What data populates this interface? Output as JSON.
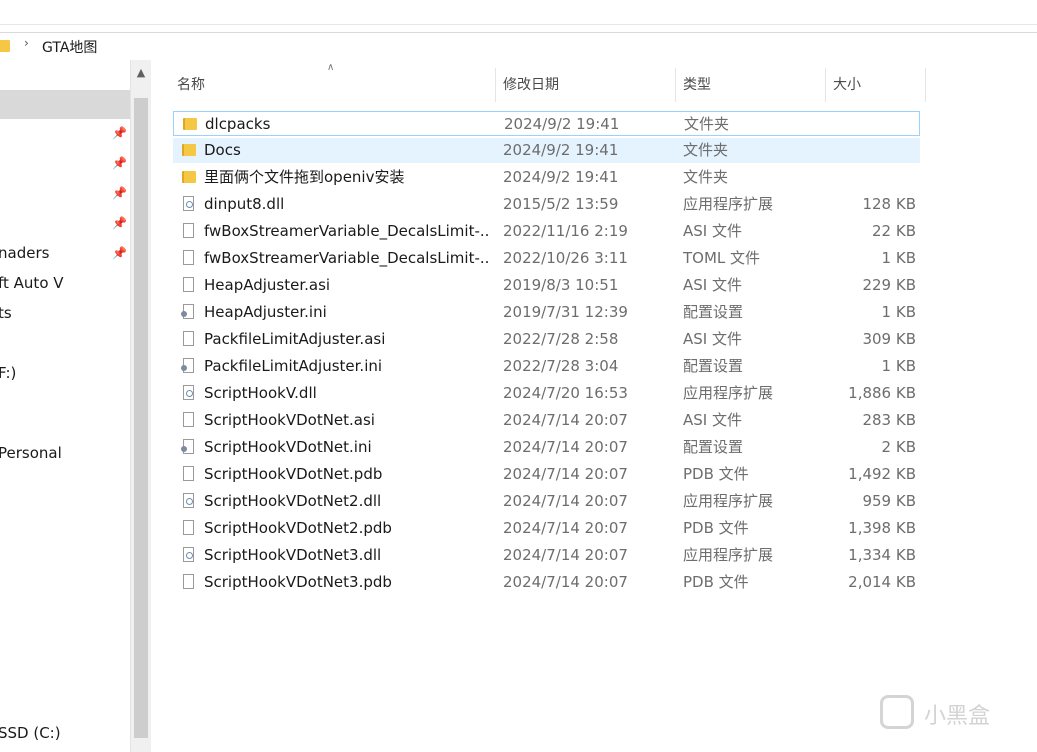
{
  "address": {
    "path": "GTA地图"
  },
  "nav": {
    "labels": [
      "naders",
      "ft Auto V",
      "ts",
      "F:)",
      "Personal",
      "SSD (C:)"
    ]
  },
  "columns": {
    "name": "名称",
    "date": "修改日期",
    "type": "类型",
    "size": "大小"
  },
  "files": [
    {
      "name": "dlcpacks",
      "date": "2024/9/2 19:41",
      "type": "文件夹",
      "size": "",
      "icon": "folder-icon"
    },
    {
      "name": "Docs",
      "date": "2024/9/2 19:41",
      "type": "文件夹",
      "size": "",
      "icon": "folder-icon"
    },
    {
      "name": "里面俩个文件拖到openiv安装",
      "date": "2024/9/2 19:41",
      "type": "文件夹",
      "size": "",
      "icon": "folder-icon"
    },
    {
      "name": "dinput8.dll",
      "date": "2015/5/2 13:59",
      "type": "应用程序扩展",
      "size": "128 KB",
      "icon": "dll-file-icon"
    },
    {
      "name": "fwBoxStreamerVariable_DecalsLimit-...",
      "date": "2022/11/16 2:19",
      "type": "ASI 文件",
      "size": "22 KB",
      "icon": "file-icon"
    },
    {
      "name": "fwBoxStreamerVariable_DecalsLimit-...",
      "date": "2022/10/26 3:11",
      "type": "TOML 文件",
      "size": "1 KB",
      "icon": "file-icon"
    },
    {
      "name": "HeapAdjuster.asi",
      "date": "2019/8/3 10:51",
      "type": "ASI 文件",
      "size": "229 KB",
      "icon": "file-icon"
    },
    {
      "name": "HeapAdjuster.ini",
      "date": "2019/7/31 12:39",
      "type": "配置设置",
      "size": "1 KB",
      "icon": "config-file-icon"
    },
    {
      "name": "PackfileLimitAdjuster.asi",
      "date": "2022/7/28 2:58",
      "type": "ASI 文件",
      "size": "309 KB",
      "icon": "file-icon"
    },
    {
      "name": "PackfileLimitAdjuster.ini",
      "date": "2022/7/28 3:04",
      "type": "配置设置",
      "size": "1 KB",
      "icon": "config-file-icon"
    },
    {
      "name": "ScriptHookV.dll",
      "date": "2024/7/20 16:53",
      "type": "应用程序扩展",
      "size": "1,886 KB",
      "icon": "dll-file-icon"
    },
    {
      "name": "ScriptHookVDotNet.asi",
      "date": "2024/7/14 20:07",
      "type": "ASI 文件",
      "size": "283 KB",
      "icon": "file-icon"
    },
    {
      "name": "ScriptHookVDotNet.ini",
      "date": "2024/7/14 20:07",
      "type": "配置设置",
      "size": "2 KB",
      "icon": "config-file-icon"
    },
    {
      "name": "ScriptHookVDotNet.pdb",
      "date": "2024/7/14 20:07",
      "type": "PDB 文件",
      "size": "1,492 KB",
      "icon": "file-icon"
    },
    {
      "name": "ScriptHookVDotNet2.dll",
      "date": "2024/7/14 20:07",
      "type": "应用程序扩展",
      "size": "959 KB",
      "icon": "dll-file-icon"
    },
    {
      "name": "ScriptHookVDotNet2.pdb",
      "date": "2024/7/14 20:07",
      "type": "PDB 文件",
      "size": "1,398 KB",
      "icon": "file-icon"
    },
    {
      "name": "ScriptHookVDotNet3.dll",
      "date": "2024/7/14 20:07",
      "type": "应用程序扩展",
      "size": "1,334 KB",
      "icon": "dll-file-icon"
    },
    {
      "name": "ScriptHookVDotNet3.pdb",
      "date": "2024/7/14 20:07",
      "type": "PDB 文件",
      "size": "2,014 KB",
      "icon": "file-icon"
    }
  ],
  "watermark": {
    "text": "小黑盒"
  },
  "colors": {
    "folder": "#f6c744",
    "hover": "#e5f3ff",
    "focus_border": "#99d1ff",
    "nav_selected": "#d9d9d9"
  }
}
